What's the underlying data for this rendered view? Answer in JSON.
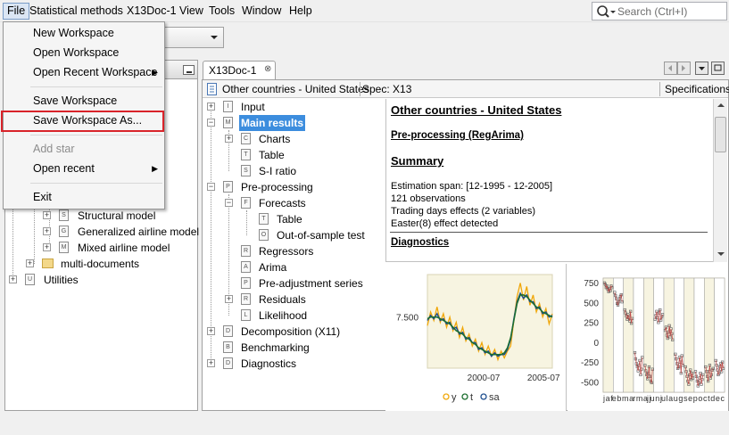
{
  "menubar": {
    "items": [
      "File",
      "Statistical methods",
      "X13Doc-1",
      "View",
      "Tools",
      "Window",
      "Help"
    ],
    "search_placeholder": "Search (Ctrl+I)"
  },
  "file_menu": {
    "items": [
      {
        "label": "New Workspace"
      },
      {
        "label": "Open Workspace"
      },
      {
        "label": "Open Recent Workspace"
      },
      {
        "label": "Save Workspace"
      },
      {
        "label": "Save Workspace As..."
      },
      {
        "label": "Add star"
      },
      {
        "label": "Open recent"
      },
      {
        "label": "Exit"
      }
    ]
  },
  "left_tree": {
    "items": [
      "Structural model",
      "Generalized airline model",
      "Mixed airline model",
      "multi-documents",
      "Utilities"
    ],
    "icons": [
      "S",
      "G",
      "M"
    ],
    "util_icon": "U"
  },
  "doc": {
    "tab_label": "X13Doc-1",
    "tab_close": "⊗",
    "series_name": "Other countries - United States",
    "spec": "Spec: X13",
    "specifications": "Specifications"
  },
  "output_tree": [
    {
      "label": "Input",
      "icon": "I"
    },
    {
      "label": "Main results",
      "icon": "M"
    },
    {
      "label": "Charts",
      "icon": "C"
    },
    {
      "label": "Table",
      "icon": "T"
    },
    {
      "label": "S-I ratio",
      "icon": "S"
    },
    {
      "label": "Pre-processing",
      "icon": "P"
    },
    {
      "label": "Forecasts",
      "icon": "F"
    },
    {
      "label": "Table",
      "icon": "T"
    },
    {
      "label": "Out-of-sample test",
      "icon": "O"
    },
    {
      "label": "Regressors",
      "icon": "R"
    },
    {
      "label": "Arima",
      "icon": "A"
    },
    {
      "label": "Pre-adjustment series",
      "icon": "P"
    },
    {
      "label": "Residuals",
      "icon": "R"
    },
    {
      "label": "Likelihood",
      "icon": "L"
    },
    {
      "label": "Decomposition (X11)",
      "icon": "D"
    },
    {
      "label": "Benchmarking",
      "icon": "B"
    },
    {
      "label": "Diagnostics",
      "icon": "D"
    }
  ],
  "result": {
    "title": "Other countries - United States",
    "preprocessing": "Pre-processing (RegArima)",
    "summary": "Summary",
    "lines": [
      "Estimation span: [12-1995 - 12-2005]",
      "121 observations",
      "Trading days effects (2 variables)",
      "Easter(8) effect detected"
    ],
    "diagnostics": "Diagnostics"
  },
  "chart_data": [
    {
      "type": "line",
      "yticks": [
        "7.500"
      ],
      "xticks": [
        "2000-07",
        "2005-07"
      ],
      "legend": [
        "y",
        "t",
        "sa"
      ],
      "colors": {
        "y": "#f0a70a",
        "t": "#1b6e2e",
        "sa": "#1f4f8f"
      },
      "series": [
        {
          "name": "y",
          "values": [
            7.45,
            7.53,
            7.48,
            7.56,
            7.47,
            7.52,
            7.44,
            7.5,
            7.42,
            7.47,
            7.38,
            7.44,
            7.36,
            7.4,
            7.33,
            7.37,
            7.3,
            7.35,
            7.28,
            7.33,
            7.27,
            7.31,
            7.25,
            7.3,
            7.26,
            7.3,
            7.33,
            7.48,
            7.62,
            7.7,
            7.6,
            7.68,
            7.57,
            7.63,
            7.53,
            7.58,
            7.5,
            7.55,
            7.46,
            7.52
          ]
        },
        {
          "name": "t",
          "values": [
            7.49,
            7.5,
            7.5,
            7.5,
            7.49,
            7.48,
            7.47,
            7.46,
            7.44,
            7.42,
            7.41,
            7.4,
            7.38,
            7.37,
            7.35,
            7.34,
            7.32,
            7.31,
            7.3,
            7.29,
            7.28,
            7.28,
            7.28,
            7.28,
            7.29,
            7.32,
            7.38,
            7.48,
            7.58,
            7.63,
            7.63,
            7.62,
            7.6,
            7.58,
            7.56,
            7.55,
            7.53,
            7.52,
            7.51,
            7.5
          ]
        },
        {
          "name": "sa",
          "values": [
            7.48,
            7.51,
            7.49,
            7.52,
            7.48,
            7.49,
            7.46,
            7.47,
            7.43,
            7.44,
            7.4,
            7.41,
            7.37,
            7.38,
            7.35,
            7.35,
            7.31,
            7.32,
            7.29,
            7.3,
            7.27,
            7.29,
            7.27,
            7.28,
            7.28,
            7.31,
            7.37,
            7.49,
            7.59,
            7.64,
            7.61,
            7.63,
            7.59,
            7.59,
            7.55,
            7.56,
            7.52,
            7.53,
            7.5,
            7.51
          ]
        }
      ]
    },
    {
      "type": "scatter",
      "yticks": [
        "750",
        "500",
        "250",
        "0",
        "-250",
        "-500"
      ],
      "ylim": [
        -620,
        820
      ],
      "xticks": "j a fe b m ar m aj ju n ju l a u g s e p o c t d e c",
      "months": 12,
      "points_per_month": [
        [
          760,
          740,
          700,
          720,
          680,
          650,
          690,
          660,
          720,
          700
        ],
        [
          640,
          600,
          560,
          500,
          480,
          520,
          560,
          590,
          610,
          520
        ],
        [
          420,
          380,
          340,
          300,
          360,
          320,
          280,
          400,
          250,
          310
        ],
        [
          -120,
          -200,
          -260,
          -300,
          -350,
          -280,
          -220,
          -400,
          -330,
          -180
        ],
        [
          -280,
          -350,
          -400,
          -450,
          -380,
          -300,
          -420,
          -480,
          -500,
          -330
        ],
        [
          300,
          350,
          400,
          320,
          260,
          380,
          420,
          290,
          330,
          360
        ],
        [
          160,
          200,
          100,
          60,
          140,
          220,
          80,
          180,
          120,
          40
        ],
        [
          -140,
          -200,
          -260,
          -320,
          -300,
          -180,
          -240,
          -380,
          -160,
          -280
        ],
        [
          -300,
          -360,
          -420,
          -480,
          -520,
          -400,
          -340,
          -460,
          -380,
          -440
        ],
        [
          -360,
          -420,
          -480,
          -540,
          -500,
          -440,
          -380,
          -520,
          -460,
          -400
        ],
        [
          -300,
          -360,
          -420,
          -480,
          -360,
          -280,
          -440,
          -400,
          -340,
          -320
        ],
        [
          -220,
          -280,
          -340,
          -400,
          -380,
          -300,
          -260,
          -360,
          -240,
          -320
        ]
      ]
    }
  ]
}
